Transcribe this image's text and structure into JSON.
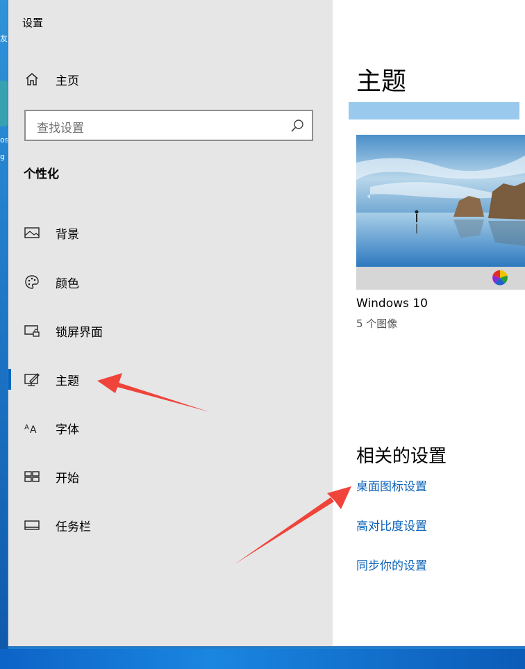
{
  "desktop": {
    "fragments": [
      "友",
      "os",
      "g"
    ]
  },
  "window": {
    "app_title": "设置"
  },
  "sidebar": {
    "home_label": "主页",
    "search_placeholder": "查找设置",
    "section_title": "个性化",
    "items": [
      {
        "label": "背景",
        "icon": "picture-icon",
        "selected": false
      },
      {
        "label": "颜色",
        "icon": "palette-icon",
        "selected": false
      },
      {
        "label": "锁屏界面",
        "icon": "lockscreen-icon",
        "selected": false
      },
      {
        "label": "主题",
        "icon": "theme-brush-icon",
        "selected": true
      },
      {
        "label": "字体",
        "icon": "font-icon",
        "selected": false
      },
      {
        "label": "开始",
        "icon": "start-grid-icon",
        "selected": false
      },
      {
        "label": "任务栏",
        "icon": "taskbar-icon",
        "selected": false
      }
    ]
  },
  "main": {
    "page_title": "主题",
    "theme": {
      "name": "Windows 10",
      "count": "5 个图像"
    },
    "related": {
      "title": "相关的设置",
      "links": [
        "桌面图标设置",
        "高对比度设置",
        "同步你的设置"
      ]
    }
  },
  "colors": {
    "sidebar_bg": "#e6e6e6",
    "accent": "#0067c0",
    "link": "#0a62b8",
    "arrow": "#f0433a"
  }
}
